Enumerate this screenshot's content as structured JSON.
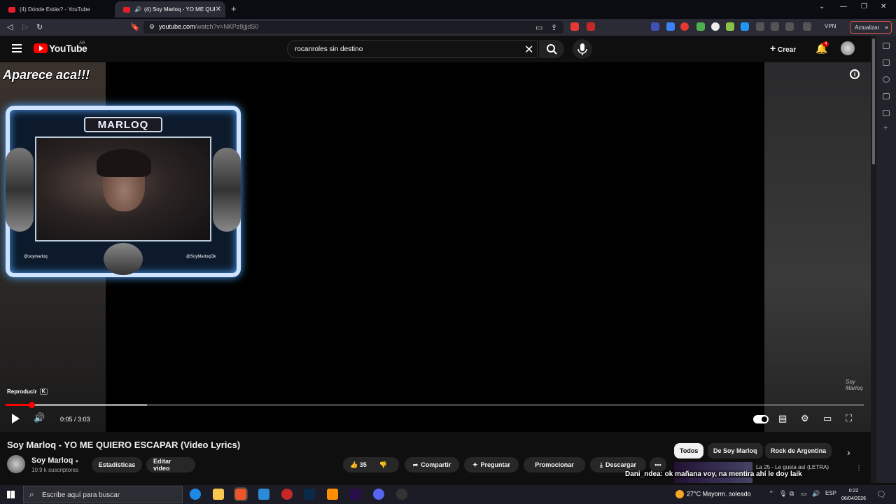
{
  "browser": {
    "tabs": [
      {
        "label": "(4) Dónde Estás? - YouTube"
      },
      {
        "label": "(4) Soy Marloq - YO ME QUI"
      }
    ],
    "url_domain": "youtube.com",
    "url_path": "/watch?v=NKPz8jjjdS0",
    "vpn_label": "VPN",
    "update_label": "Actualizar",
    "ext_badge": "6"
  },
  "youtube": {
    "logo_text": "YouTube",
    "country": "AR",
    "search_value": "rocanroles sin destino",
    "create_label": "Crear",
    "notif_count": "4"
  },
  "player": {
    "overlay_text": "Aparece aca!!!",
    "frame_name": "MARLOQ",
    "handle_left": "@soymarloq",
    "handle_right": "@SoyMarloqOk",
    "watermark": "Soy Marloq",
    "tooltip_label": "Reproducir",
    "tooltip_key": "K",
    "time": "0:05 / 3:03",
    "progress_fraction": 0.03,
    "buffered_fraction": 0.165
  },
  "video": {
    "title": "Soy Marloq - YO ME QUIERO ESCAPAR (Video Lyrics)",
    "channel_name": "Soy Marloq",
    "subscribers": "10.9 k suscriptores",
    "stats_label": "Estadísticas",
    "edit_label": "Editar video",
    "likes": "35",
    "share_label": "Compartir",
    "ask_label": "Preguntar",
    "promote_label": "Promocionar",
    "download_label": "Descargar"
  },
  "chips": [
    {
      "label": "Todos"
    },
    {
      "label": "De Soy Marloq"
    },
    {
      "label": "Rock de Argentina"
    }
  ],
  "related": {
    "title": "La 25 - Le gusta así (LETRA)"
  },
  "chat": {
    "user": "Dani_ndea",
    "message": ": ok mañana voy, na mentira ahí le doy laik"
  },
  "taskbar": {
    "search_placeholder": "Escribe aquí para buscar",
    "weather": "27°C  Mayorm. soleado",
    "lang": "ESP",
    "time": "0:22",
    "date": "06/04/2026"
  }
}
